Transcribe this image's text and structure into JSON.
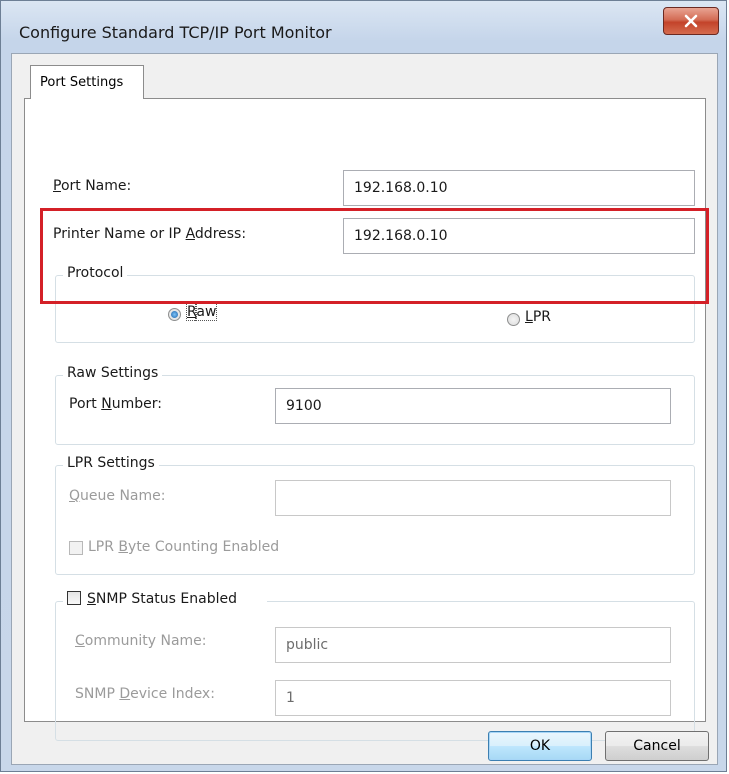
{
  "window": {
    "title": "Configure Standard TCP/IP Port Monitor",
    "close_icon": "close-icon"
  },
  "tabs": [
    {
      "label": "Port Settings",
      "selected": true
    }
  ],
  "port_settings": {
    "port_name": {
      "label_pre": "",
      "label_key": "P",
      "label_post": "ort Name:",
      "value": "192.168.0.10"
    },
    "printer_address": {
      "label_pre": "Printer Name or IP ",
      "label_key": "A",
      "label_post": "ddress:",
      "value": "192.168.0.10"
    }
  },
  "protocol": {
    "title": "Protocol",
    "raw": {
      "label_pre": "",
      "label_key": "R",
      "label_post": "aw",
      "checked": true
    },
    "lpr": {
      "label_pre": "",
      "label_key": "L",
      "label_post": "PR",
      "checked": false
    }
  },
  "raw_settings": {
    "title": "Raw Settings",
    "port_number": {
      "label_pre": "Port ",
      "label_key": "N",
      "label_post": "umber:",
      "value": "9100"
    }
  },
  "lpr_settings": {
    "title": "LPR Settings",
    "queue_name": {
      "label_pre": "",
      "label_key": "Q",
      "label_post": "ueue Name:",
      "value": ""
    },
    "byte_counting": {
      "label_pre": "LPR ",
      "label_key": "B",
      "label_post": "yte Counting Enabled",
      "checked": false
    }
  },
  "snmp": {
    "enabled": {
      "label_pre": "",
      "label_key": "S",
      "label_post": "NMP Status Enabled",
      "checked": false
    },
    "community": {
      "label_pre": "",
      "label_key": "C",
      "label_post": "ommunity Name:",
      "value": "public"
    },
    "device_index": {
      "label_pre": "SNMP ",
      "label_key": "D",
      "label_post": "evice Index:",
      "value": "1"
    }
  },
  "buttons": {
    "ok": "OK",
    "cancel": "Cancel"
  },
  "colors": {
    "highlight": "#d42027"
  }
}
